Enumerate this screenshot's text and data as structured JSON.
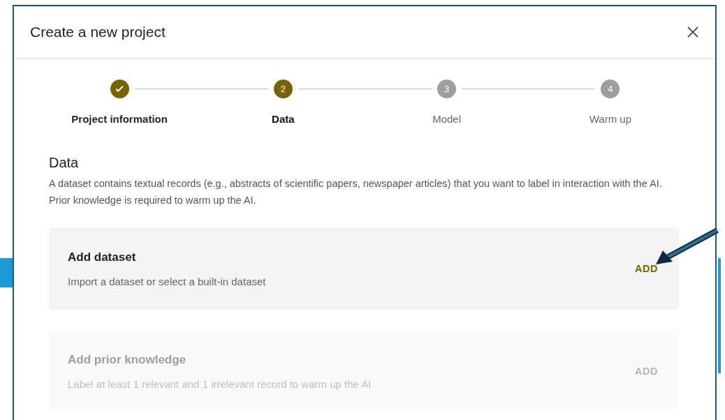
{
  "dialog": {
    "title": "Create a new project"
  },
  "steps": [
    {
      "label": "Project information",
      "completed": true,
      "selected": false
    },
    {
      "label": "Data",
      "number": "2",
      "completed": false,
      "selected": true
    },
    {
      "label": "Model",
      "number": "3",
      "completed": false,
      "selected": false
    },
    {
      "label": "Warm up",
      "number": "4",
      "completed": false,
      "selected": false
    }
  ],
  "section": {
    "heading": "Data",
    "description": "A dataset contains textual records (e.g., abstracts of scientific papers, newspaper articles) that you want to label in interaction with the AI. Prior knowledge is required to warm up the AI."
  },
  "cards": [
    {
      "title": "Add dataset",
      "description": "Import a dataset or select a built-in dataset",
      "action": "ADD",
      "disabled": false
    },
    {
      "title": "Add prior knowledge",
      "description": "Label at least 1 relevant and 1 irrelevant record to warm up the AI",
      "action": "ADD",
      "disabled": true
    }
  ]
}
